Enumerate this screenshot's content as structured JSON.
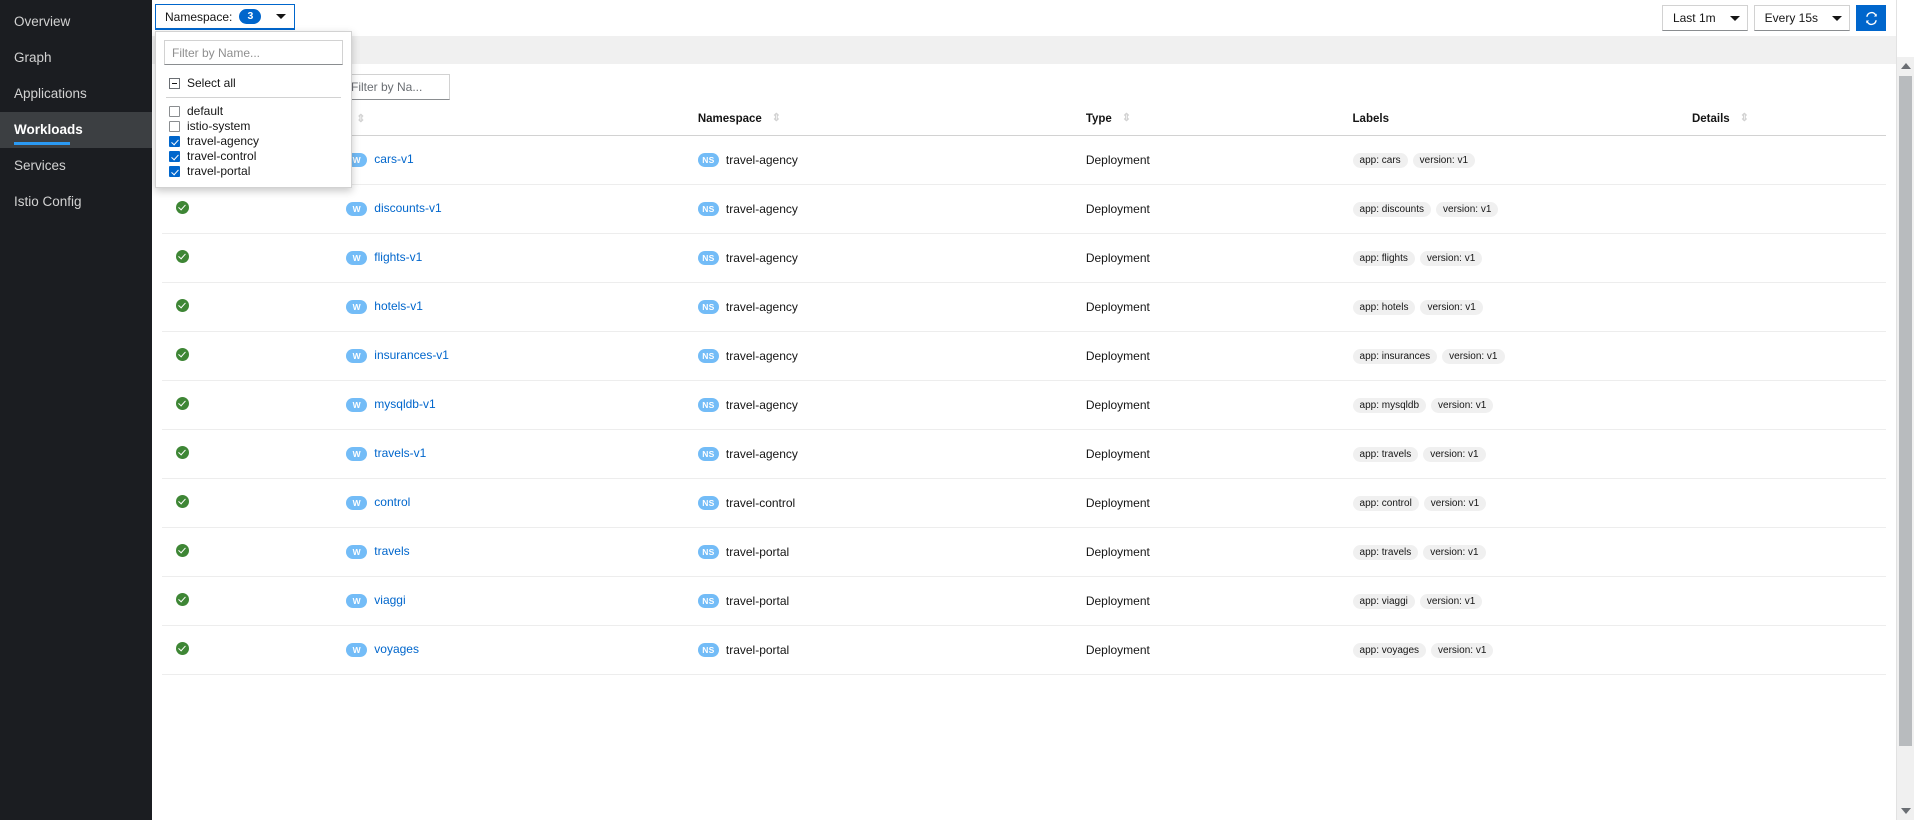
{
  "sidebar": {
    "items": [
      {
        "label": "Overview",
        "active": false
      },
      {
        "label": "Graph",
        "active": false
      },
      {
        "label": "Applications",
        "active": false
      },
      {
        "label": "Workloads",
        "active": true
      },
      {
        "label": "Services",
        "active": false
      },
      {
        "label": "Istio Config",
        "active": false
      }
    ]
  },
  "toolbar": {
    "namespace_label": "Namespace:",
    "namespace_count": "3",
    "time_range": "Last 1m",
    "refresh_interval": "Every 15s",
    "refresh_icon": "refresh-icon"
  },
  "namespace_menu": {
    "filter_placeholder": "Filter by Name...",
    "filter_value": "",
    "select_all_label": "Select all",
    "options": [
      {
        "label": "default",
        "checked": false
      },
      {
        "label": "istio-system",
        "checked": false
      },
      {
        "label": "travel-agency",
        "checked": true
      },
      {
        "label": "travel-control",
        "checked": true
      },
      {
        "label": "travel-portal",
        "checked": true
      }
    ]
  },
  "filter_bar": {
    "filter_placeholder": "Filter by Na...",
    "filter_value": ""
  },
  "table": {
    "columns": [
      {
        "key": "health",
        "label": ""
      },
      {
        "key": "name",
        "label": ""
      },
      {
        "key": "namespace",
        "label": "Namespace"
      },
      {
        "key": "type",
        "label": "Type"
      },
      {
        "key": "labels",
        "label": "Labels"
      },
      {
        "key": "details",
        "label": "Details"
      }
    ],
    "rows": [
      {
        "health": "healthy",
        "badge": "W",
        "name": "cars-v1",
        "ns_badge": "NS",
        "namespace": "travel-agency",
        "type": "Deployment",
        "labels": [
          "app: cars",
          "version: v1"
        ],
        "details": ""
      },
      {
        "health": "healthy",
        "badge": "W",
        "name": "discounts-v1",
        "ns_badge": "NS",
        "namespace": "travel-agency",
        "type": "Deployment",
        "labels": [
          "app: discounts",
          "version: v1"
        ],
        "details": ""
      },
      {
        "health": "healthy",
        "badge": "W",
        "name": "flights-v1",
        "ns_badge": "NS",
        "namespace": "travel-agency",
        "type": "Deployment",
        "labels": [
          "app: flights",
          "version: v1"
        ],
        "details": ""
      },
      {
        "health": "healthy",
        "badge": "W",
        "name": "hotels-v1",
        "ns_badge": "NS",
        "namespace": "travel-agency",
        "type": "Deployment",
        "labels": [
          "app: hotels",
          "version: v1"
        ],
        "details": ""
      },
      {
        "health": "healthy",
        "badge": "W",
        "name": "insurances-v1",
        "ns_badge": "NS",
        "namespace": "travel-agency",
        "type": "Deployment",
        "labels": [
          "app: insurances",
          "version: v1"
        ],
        "details": ""
      },
      {
        "health": "healthy",
        "badge": "W",
        "name": "mysqldb-v1",
        "ns_badge": "NS",
        "namespace": "travel-agency",
        "type": "Deployment",
        "labels": [
          "app: mysqldb",
          "version: v1"
        ],
        "details": ""
      },
      {
        "health": "healthy",
        "badge": "W",
        "name": "travels-v1",
        "ns_badge": "NS",
        "namespace": "travel-agency",
        "type": "Deployment",
        "labels": [
          "app: travels",
          "version: v1"
        ],
        "details": ""
      },
      {
        "health": "healthy",
        "badge": "W",
        "name": "control",
        "ns_badge": "NS",
        "namespace": "travel-control",
        "type": "Deployment",
        "labels": [
          "app: control",
          "version: v1"
        ],
        "details": ""
      },
      {
        "health": "healthy",
        "badge": "W",
        "name": "travels",
        "ns_badge": "NS",
        "namespace": "travel-portal",
        "type": "Deployment",
        "labels": [
          "app: travels",
          "version: v1"
        ],
        "details": ""
      },
      {
        "health": "healthy",
        "badge": "W",
        "name": "viaggi",
        "ns_badge": "NS",
        "namespace": "travel-portal",
        "type": "Deployment",
        "labels": [
          "app: viaggi",
          "version: v1"
        ],
        "details": ""
      },
      {
        "health": "healthy",
        "badge": "W",
        "name": "voyages",
        "ns_badge": "NS",
        "namespace": "travel-portal",
        "type": "Deployment",
        "labels": [
          "app: voyages",
          "version: v1"
        ],
        "details": ""
      }
    ]
  },
  "colors": {
    "accent": "#0066cc",
    "healthy": "#3e8635",
    "badge_blue": "#73bcf7",
    "sidebar_bg": "#1b1d21",
    "link": "#0066cc"
  }
}
